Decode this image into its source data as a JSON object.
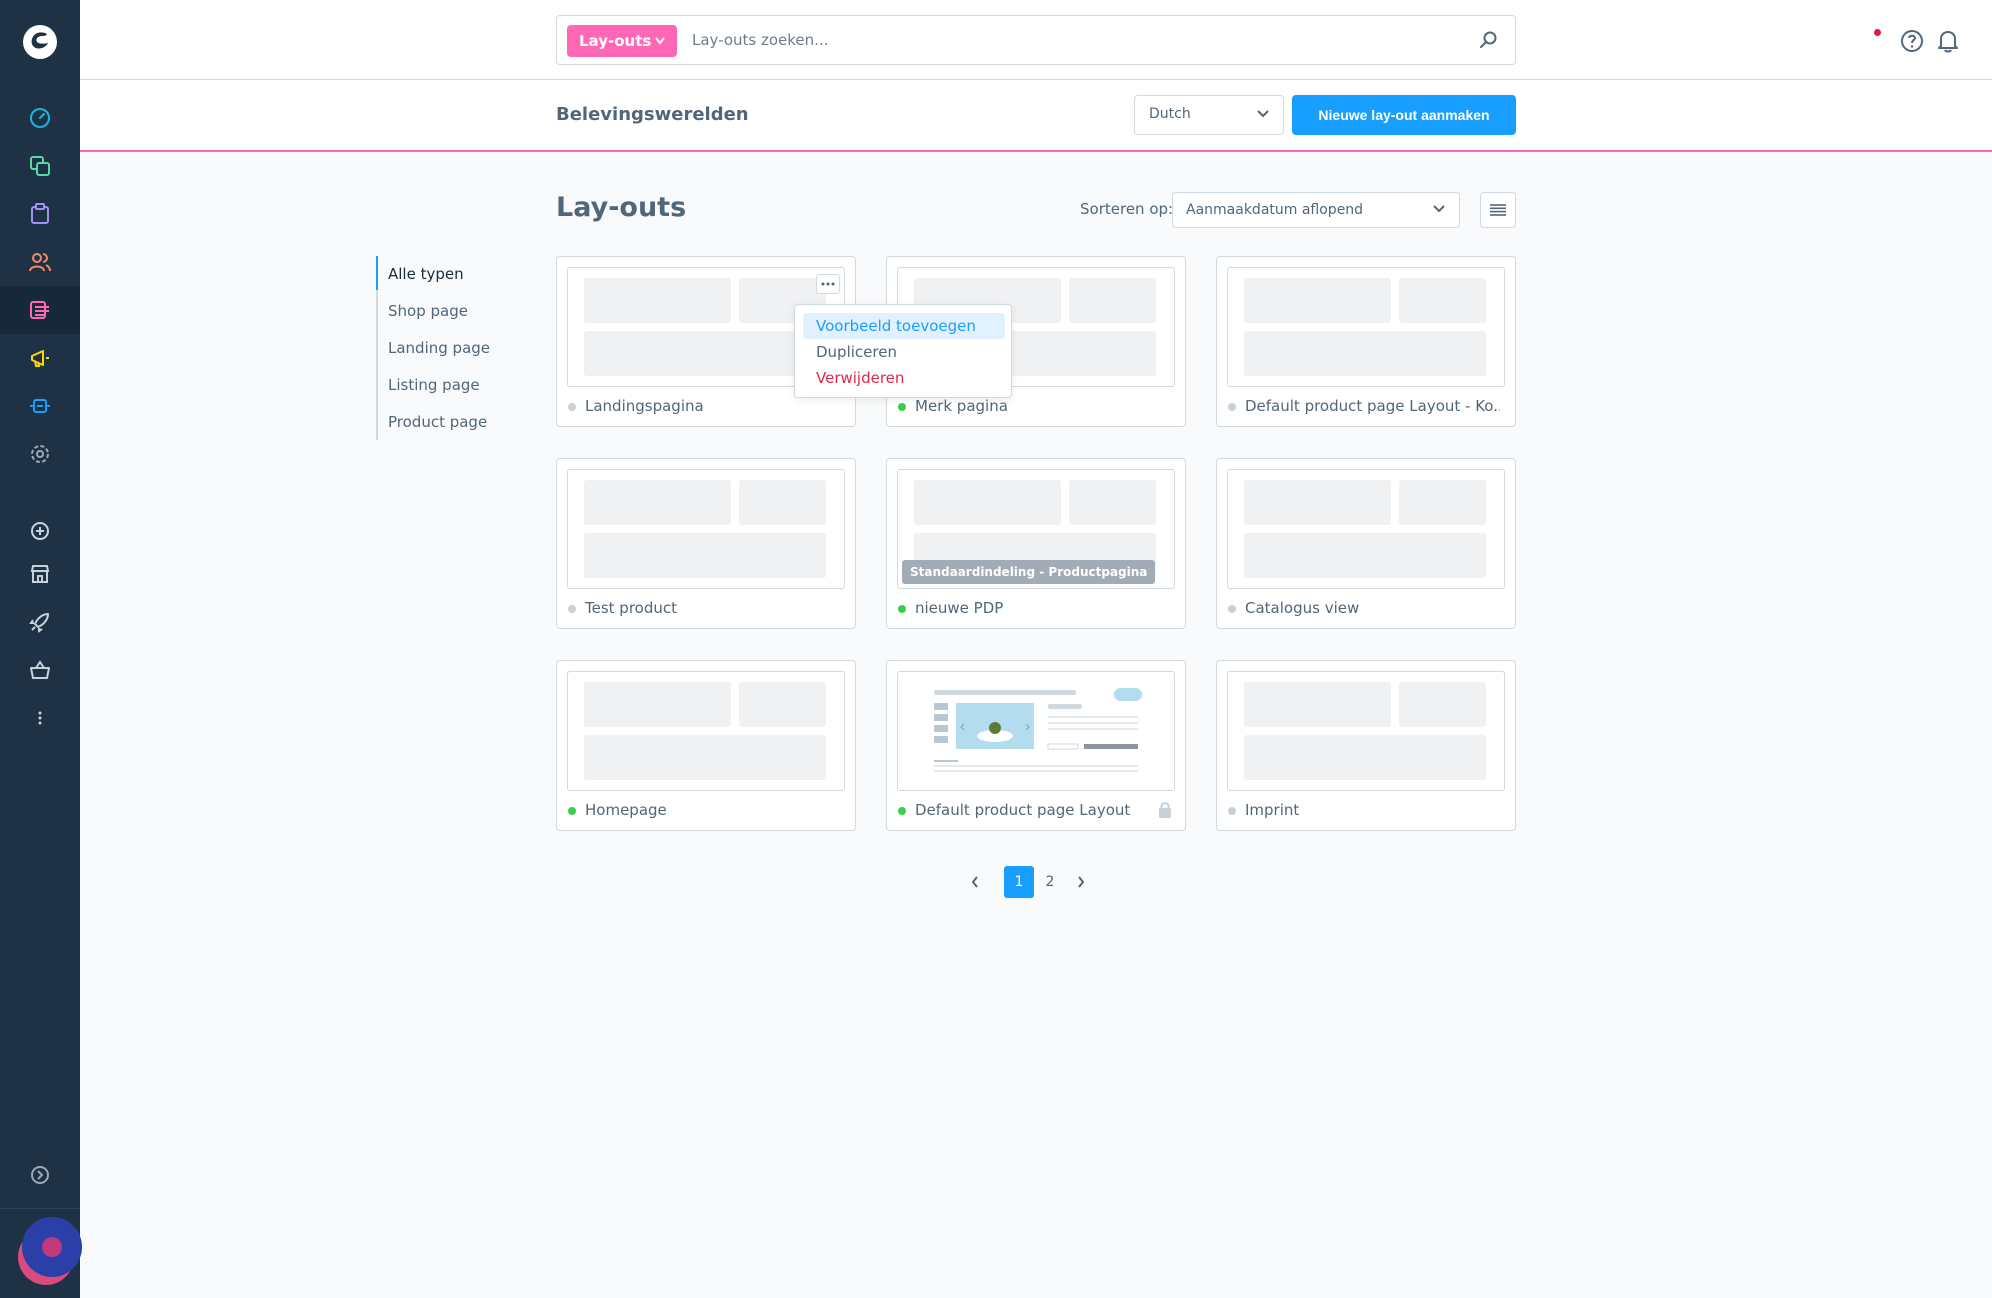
{
  "header": {
    "search_scope": "Lay-outs",
    "search_placeholder": "Lay-outs zoeken...",
    "icons": [
      "search-icon",
      "help-icon",
      "bell-icon"
    ]
  },
  "subheader": {
    "title": "Belevingswerelden",
    "language": "Dutch",
    "create_button": "Nieuwe lay-out aanmaken"
  },
  "content": {
    "title": "Lay-outs",
    "sort_label": "Sorteren op:",
    "sort_value": "Aanmaakdatum aflopend"
  },
  "type_filter": {
    "items": [
      "Alle typen",
      "Shop page",
      "Landing page",
      "Listing page",
      "Product page"
    ],
    "active": "Alle typen"
  },
  "cards": [
    {
      "name": "Landingspagina",
      "active": false
    },
    {
      "name": "Merk pagina",
      "active": true
    },
    {
      "name": "Default product page Layout - Ko...",
      "active": false
    },
    {
      "name": "Test product",
      "active": false
    },
    {
      "name": "nieuwe PDP",
      "active": true,
      "badge": "Standaardindeling - Productpagina"
    },
    {
      "name": "Catalogus view",
      "active": false
    },
    {
      "name": "Homepage",
      "active": true
    },
    {
      "name": "Default product page Layout",
      "active": true,
      "locked": true
    },
    {
      "name": "Imprint",
      "active": false
    }
  ],
  "context_menu": {
    "items": [
      "Voorbeeld toevoegen",
      "Dupliceren",
      "Verwijderen"
    ]
  },
  "pagination": {
    "pages": [
      "1",
      "2"
    ],
    "current": "1"
  },
  "colors": {
    "sidebar": "#1f3245",
    "accent": "#189eff",
    "brand_pink": "#ff68b4",
    "active_status": "#37d046",
    "danger": "#de294c"
  }
}
